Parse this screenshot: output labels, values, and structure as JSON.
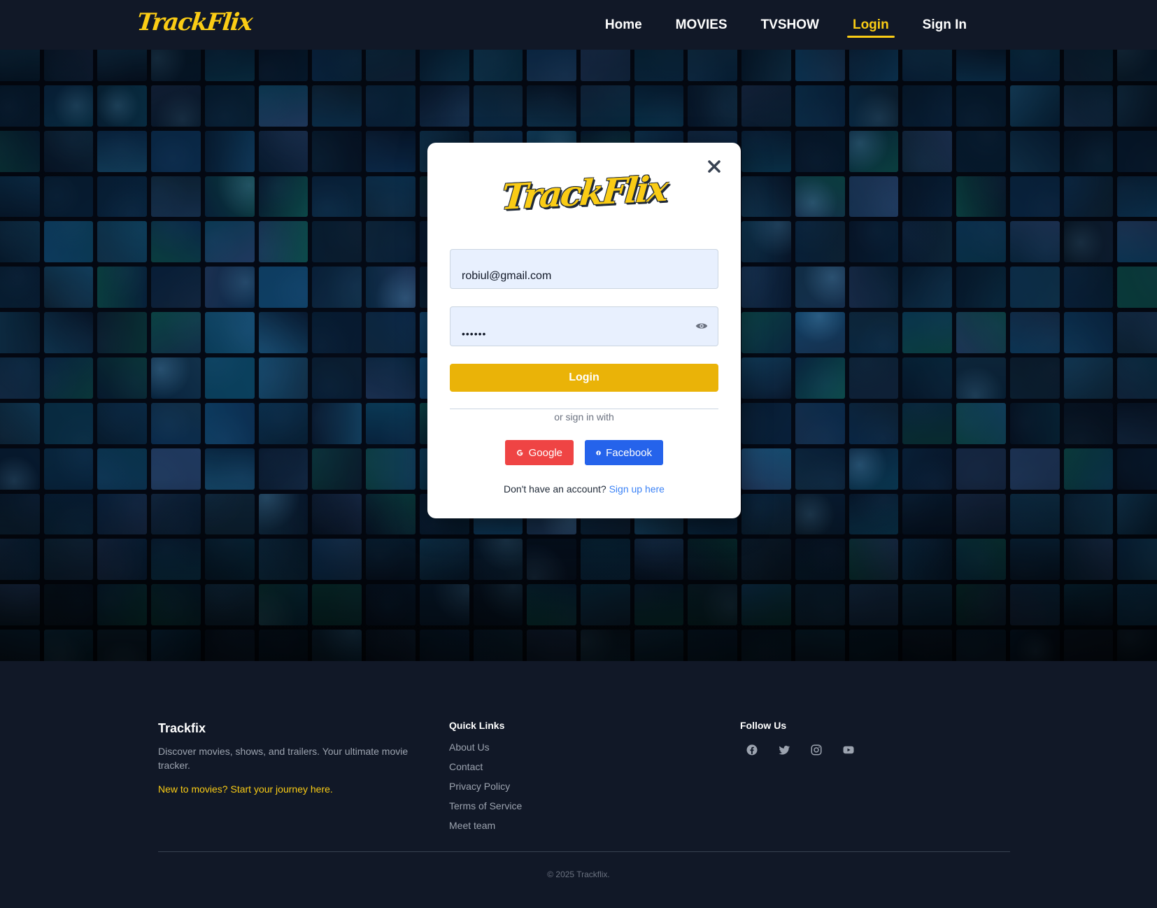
{
  "nav": {
    "brand": "TrackFlix",
    "links": [
      {
        "label": "Home",
        "active": false
      },
      {
        "label": "MOVIES",
        "active": false
      },
      {
        "label": "TVSHOW",
        "active": false
      },
      {
        "label": "Login",
        "active": true
      },
      {
        "label": "Sign In",
        "active": false
      }
    ]
  },
  "modal": {
    "logo": "TrackFlix",
    "email_value": "robiul@gmail.com",
    "password_value": "••••••",
    "login_label": "Login",
    "divider_text": "or sign in with",
    "google_label": "Google",
    "facebook_label": "Facebook",
    "signup_prompt": "Don't have an account?",
    "signup_link": "Sign up here"
  },
  "footer": {
    "brand": "Trackfix",
    "description": "Discover movies, shows, and trailers. Your ultimate movie tracker.",
    "cta": "New to movies? Start your journey here.",
    "quick_links_heading": "Quick Links",
    "quick_links": [
      "About Us",
      "Contact",
      "Privacy Policy",
      "Terms of Service",
      "Meet team"
    ],
    "follow_heading": "Follow Us",
    "social_icons": [
      "facebook-icon",
      "twitter-icon",
      "instagram-icon",
      "youtube-icon"
    ],
    "copyright": "© 2025 Trackflix."
  },
  "colors": {
    "background": "#111827",
    "accent": "#facc15",
    "login_button": "#eab308",
    "google": "#ef4444",
    "facebook": "#2563eb",
    "link": "#3b82f6"
  }
}
